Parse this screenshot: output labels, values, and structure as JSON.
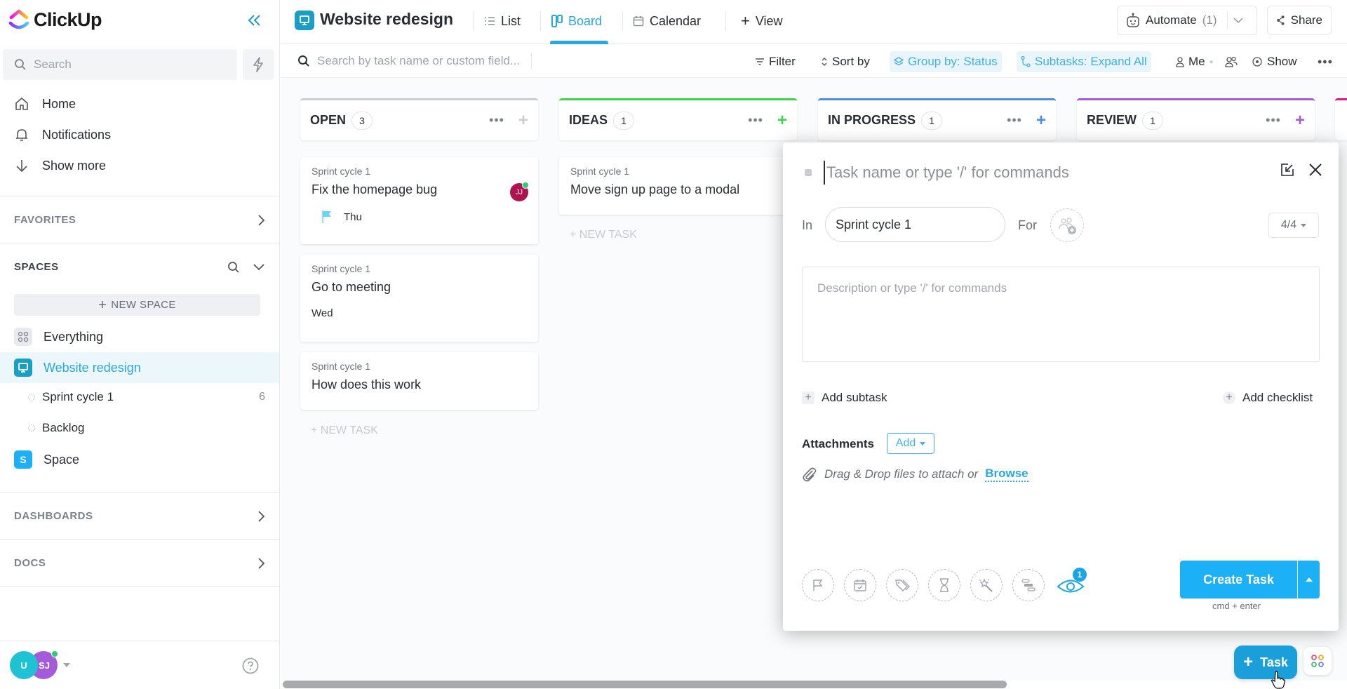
{
  "app": {
    "name": "ClickUp"
  },
  "sidebar": {
    "search_placeholder": "Search",
    "nav": [
      {
        "label": "Home",
        "icon": "home-icon"
      },
      {
        "label": "Notifications",
        "icon": "bell-icon"
      },
      {
        "label": "Show more",
        "icon": "arrow-down-icon"
      }
    ],
    "favorites_label": "FAVORITES",
    "spaces_label": "SPACES",
    "new_space_label": "NEW SPACE",
    "spaces": [
      {
        "label": "Everything",
        "icon": "grid-icon"
      },
      {
        "label": "Website redesign",
        "icon": "monitor-icon",
        "active": true
      },
      {
        "label": "Space",
        "initial": "S"
      }
    ],
    "lists": [
      {
        "label": "Sprint cycle 1",
        "count": "6"
      },
      {
        "label": "Backlog",
        "count": ""
      }
    ],
    "dashboards_label": "DASHBOARDS",
    "docs_label": "DOCS",
    "user_avatars": [
      {
        "initials": "U",
        "color": "#1fc2d2"
      },
      {
        "initials": "SJ",
        "color": "#a35bd9"
      }
    ]
  },
  "header": {
    "project_title": "Website redesign",
    "tabs": [
      {
        "label": "List",
        "icon": "list-icon"
      },
      {
        "label": "Board",
        "icon": "board-icon",
        "active": true
      },
      {
        "label": "Calendar",
        "icon": "calendar-icon"
      }
    ],
    "add_view_label": "View",
    "automate_label": "Automate",
    "automate_count": "(1)",
    "share_label": "Share"
  },
  "toolbar": {
    "search_placeholder": "Search by task name or custom field...",
    "filter_label": "Filter",
    "sort_label": "Sort by",
    "group_label": "Group by: Status",
    "subtasks_label": "Subtasks: Expand All",
    "me_label": "Me",
    "show_label": "Show"
  },
  "board": {
    "new_task_label": "+ NEW TASK",
    "columns": [
      {
        "name": "OPEN",
        "count": "3",
        "color": "#c9ccd1",
        "cards": [
          {
            "list": "Sprint cycle 1",
            "title": "Fix the homepage bug",
            "due": "Thu",
            "flag": true,
            "assignee": "JJ"
          },
          {
            "list": "Sprint cycle 1",
            "title": "Go to meeting",
            "due": "Wed"
          },
          {
            "list": "Sprint cycle 1",
            "title": "How does this work"
          }
        ]
      },
      {
        "name": "IDEAS",
        "count": "1",
        "color": "#3fd349",
        "cards": [
          {
            "list": "Sprint cycle 1",
            "title": "Move sign up page to a modal"
          }
        ]
      },
      {
        "name": "IN PROGRESS",
        "count": "1",
        "color": "#4a8fe0",
        "cards": []
      },
      {
        "name": "REVIEW",
        "count": "1",
        "color": "#a25ddc",
        "cards": []
      }
    ],
    "partial_column_color": "#d91b8c"
  },
  "modal": {
    "title_placeholder": "Task name or type '/' for commands",
    "in_label": "In",
    "in_value": "Sprint cycle 1",
    "for_label": "For",
    "count_value": "4/4",
    "description_placeholder": "Description or type '/' for commands",
    "add_subtask_label": "Add subtask",
    "add_checklist_label": "Add checklist",
    "attachments_label": "Attachments",
    "attachments_add_label": "Add",
    "drag_text": "Drag & Drop files to attach or",
    "browse_label": "Browse",
    "watchers_count": "1",
    "create_label": "Create Task",
    "create_hint": "cmd + enter"
  },
  "fab": {
    "label": "Task"
  }
}
